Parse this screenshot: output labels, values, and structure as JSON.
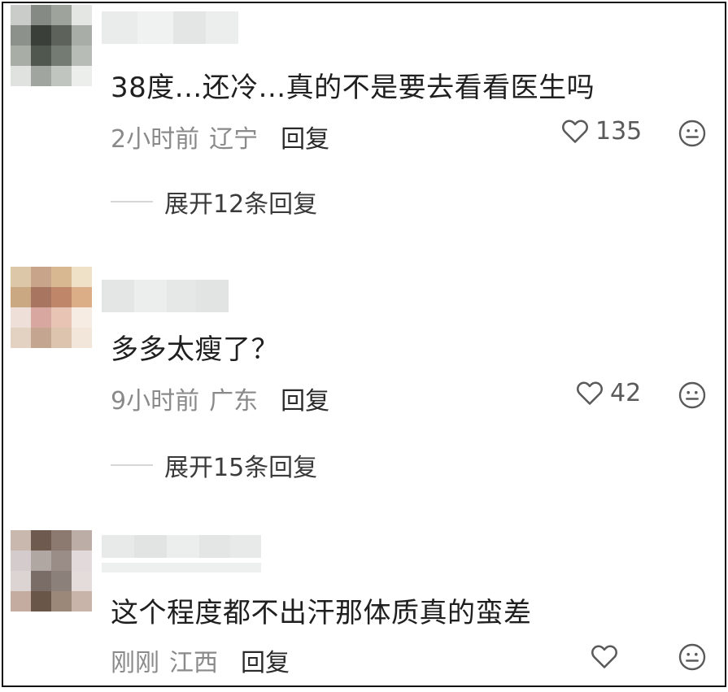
{
  "comments": [
    {
      "text": "38度...还冷...真的不是要去看看医生吗",
      "time": "2小时前",
      "location": "辽宁",
      "reply_label": "回复",
      "likes": "135",
      "like_icon": "heart-outline",
      "emoji_icon": "neutral-face-outline",
      "expand_label": "展开12条回复"
    },
    {
      "text": "多多太瘦了？",
      "time": "9小时前",
      "location": "广东",
      "reply_label": "回复",
      "likes": "42",
      "like_icon": "heart-outline",
      "emoji_icon": "neutral-face-outline",
      "expand_label": "展开15条回复"
    },
    {
      "text": "这个程度都不出汗那体质真的蛮差",
      "time": "刚刚",
      "location": "江西",
      "reply_label": "回复",
      "likes": "",
      "like_icon": "heart-outline",
      "emoji_icon": "neutral-face-outline"
    }
  ],
  "colors": {
    "text_primary": "#1f1f1f",
    "text_meta": "#8a8a8a",
    "icon_gray": "#5a5a5a",
    "border": "#111111"
  }
}
